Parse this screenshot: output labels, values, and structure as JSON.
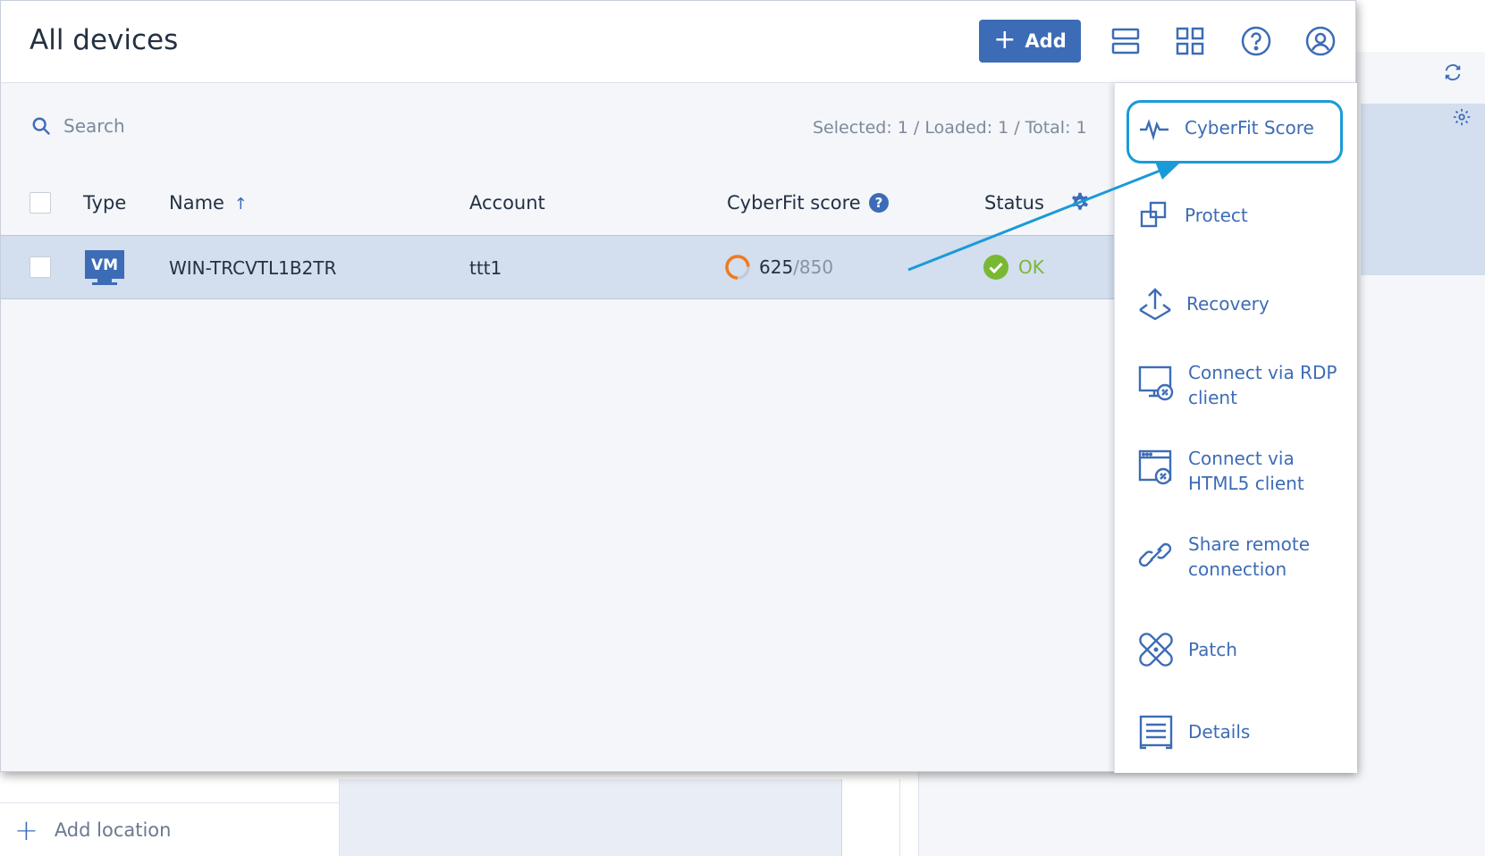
{
  "header": {
    "title": "All devices",
    "add_label": "Add"
  },
  "toolbar": {
    "search_placeholder": "Search",
    "count_info": "Selected: 1 / Loaded: 1 / Total: 1"
  },
  "table": {
    "columns": {
      "type": "Type",
      "name": "Name",
      "account": "Account",
      "cyberfit": "CyberFit score",
      "status": "Status"
    },
    "rows": [
      {
        "type_badge": "VM",
        "name": "WIN-TRCVTL1B2TR",
        "account": "ttt1",
        "score": "625",
        "score_max": "/850",
        "status": "OK"
      }
    ]
  },
  "side_menu": {
    "items": [
      {
        "label": "CyberFit Score",
        "icon": "pulse-icon"
      },
      {
        "label": "Protect",
        "icon": "protect-icon"
      },
      {
        "label": "Recovery",
        "icon": "recovery-icon"
      },
      {
        "label": "Connect via RDP client",
        "icon": "rdp-icon"
      },
      {
        "label": "Connect via HTML5 client",
        "icon": "html5-icon"
      },
      {
        "label": "Share remote connection",
        "icon": "link-icon"
      },
      {
        "label": "Patch",
        "icon": "patch-icon"
      },
      {
        "label": "Details",
        "icon": "details-icon"
      }
    ]
  },
  "background": {
    "add_location": "Add location"
  },
  "colors": {
    "accent": "#3d6cb6",
    "highlight": "#1a9ad8",
    "ok": "#7ab834",
    "score_ring": "#f07a1e",
    "selected_row": "#d3deee"
  }
}
